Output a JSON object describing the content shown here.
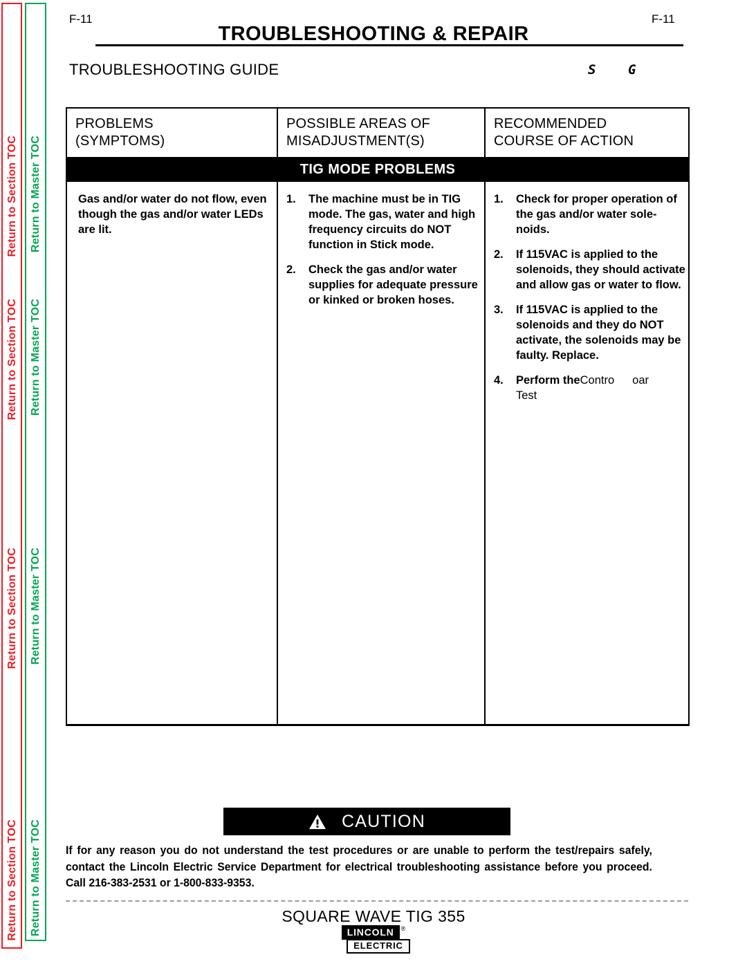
{
  "sidebar": {
    "section_tab_label": "Return to Section TOC",
    "master_tab_label": "Return to Master TOC",
    "section_color": "#ED1C24",
    "master_color": "#00A651",
    "repeats": 4
  },
  "header": {
    "folio_left": "F-11",
    "folio_right": "F-11",
    "doc_title": "TROUBLESHOOTING & REPAIR",
    "guide_title": "TROUBLESHOOTING GUIDE",
    "guide_fragment_1": "S",
    "guide_fragment_2": "G"
  },
  "table": {
    "columns": [
      {
        "line1": "PROBLEMS",
        "line2": "(SYMPTOMS)"
      },
      {
        "line1": "POSSIBLE AREAS OF",
        "line2": "MISADJUSTMENT(S)"
      },
      {
        "line1": "RECOMMENDED",
        "line2": "COURSE OF ACTION"
      }
    ],
    "band_label": "TIG MODE PROBLEMS",
    "symptom": "Gas and/or water do not flow, even though the gas and/or water LEDs are lit.",
    "misadjustments": [
      {
        "num": "1.",
        "text": "The machine must be in TIG mode.  The gas, water and high frequency circuits do NOT function in Stick mode."
      },
      {
        "num": "2.",
        "text": "Check the gas and/or water supplies for adequate pressure or kinked or broken hoses."
      }
    ],
    "actions": [
      {
        "num": "1.",
        "text": "Check for proper operation of the gas and/or water sole-noids."
      },
      {
        "num": "2.",
        "text": "If 115VAC is applied to the solenoids, they should activate and allow gas or water to flow."
      },
      {
        "num": "3.",
        "text": "If 115VAC is applied to the solenoids and they do NOT activate, the solenoids may be faulty.  Replace."
      },
      {
        "num": "4.",
        "bold_text": "Perform the",
        "frag_1": "Contro",
        "frag_2": "oar",
        "frag_3": "Test"
      }
    ]
  },
  "caution": {
    "banner_label": "CAUTION",
    "body": "If for any reason you do not understand the test procedures or are unable to perform the test/repairs safely, contact the Lincoln Electric Service Department for electrical troubleshooting assistance before you proceed.  Call 216-383-2531 or 1-800-833-9353."
  },
  "footer": {
    "model": "SQUARE WAVE TIG 355",
    "logo_primary": "LINCOLN",
    "logo_registered": "®",
    "logo_secondary": "ELECTRIC"
  }
}
